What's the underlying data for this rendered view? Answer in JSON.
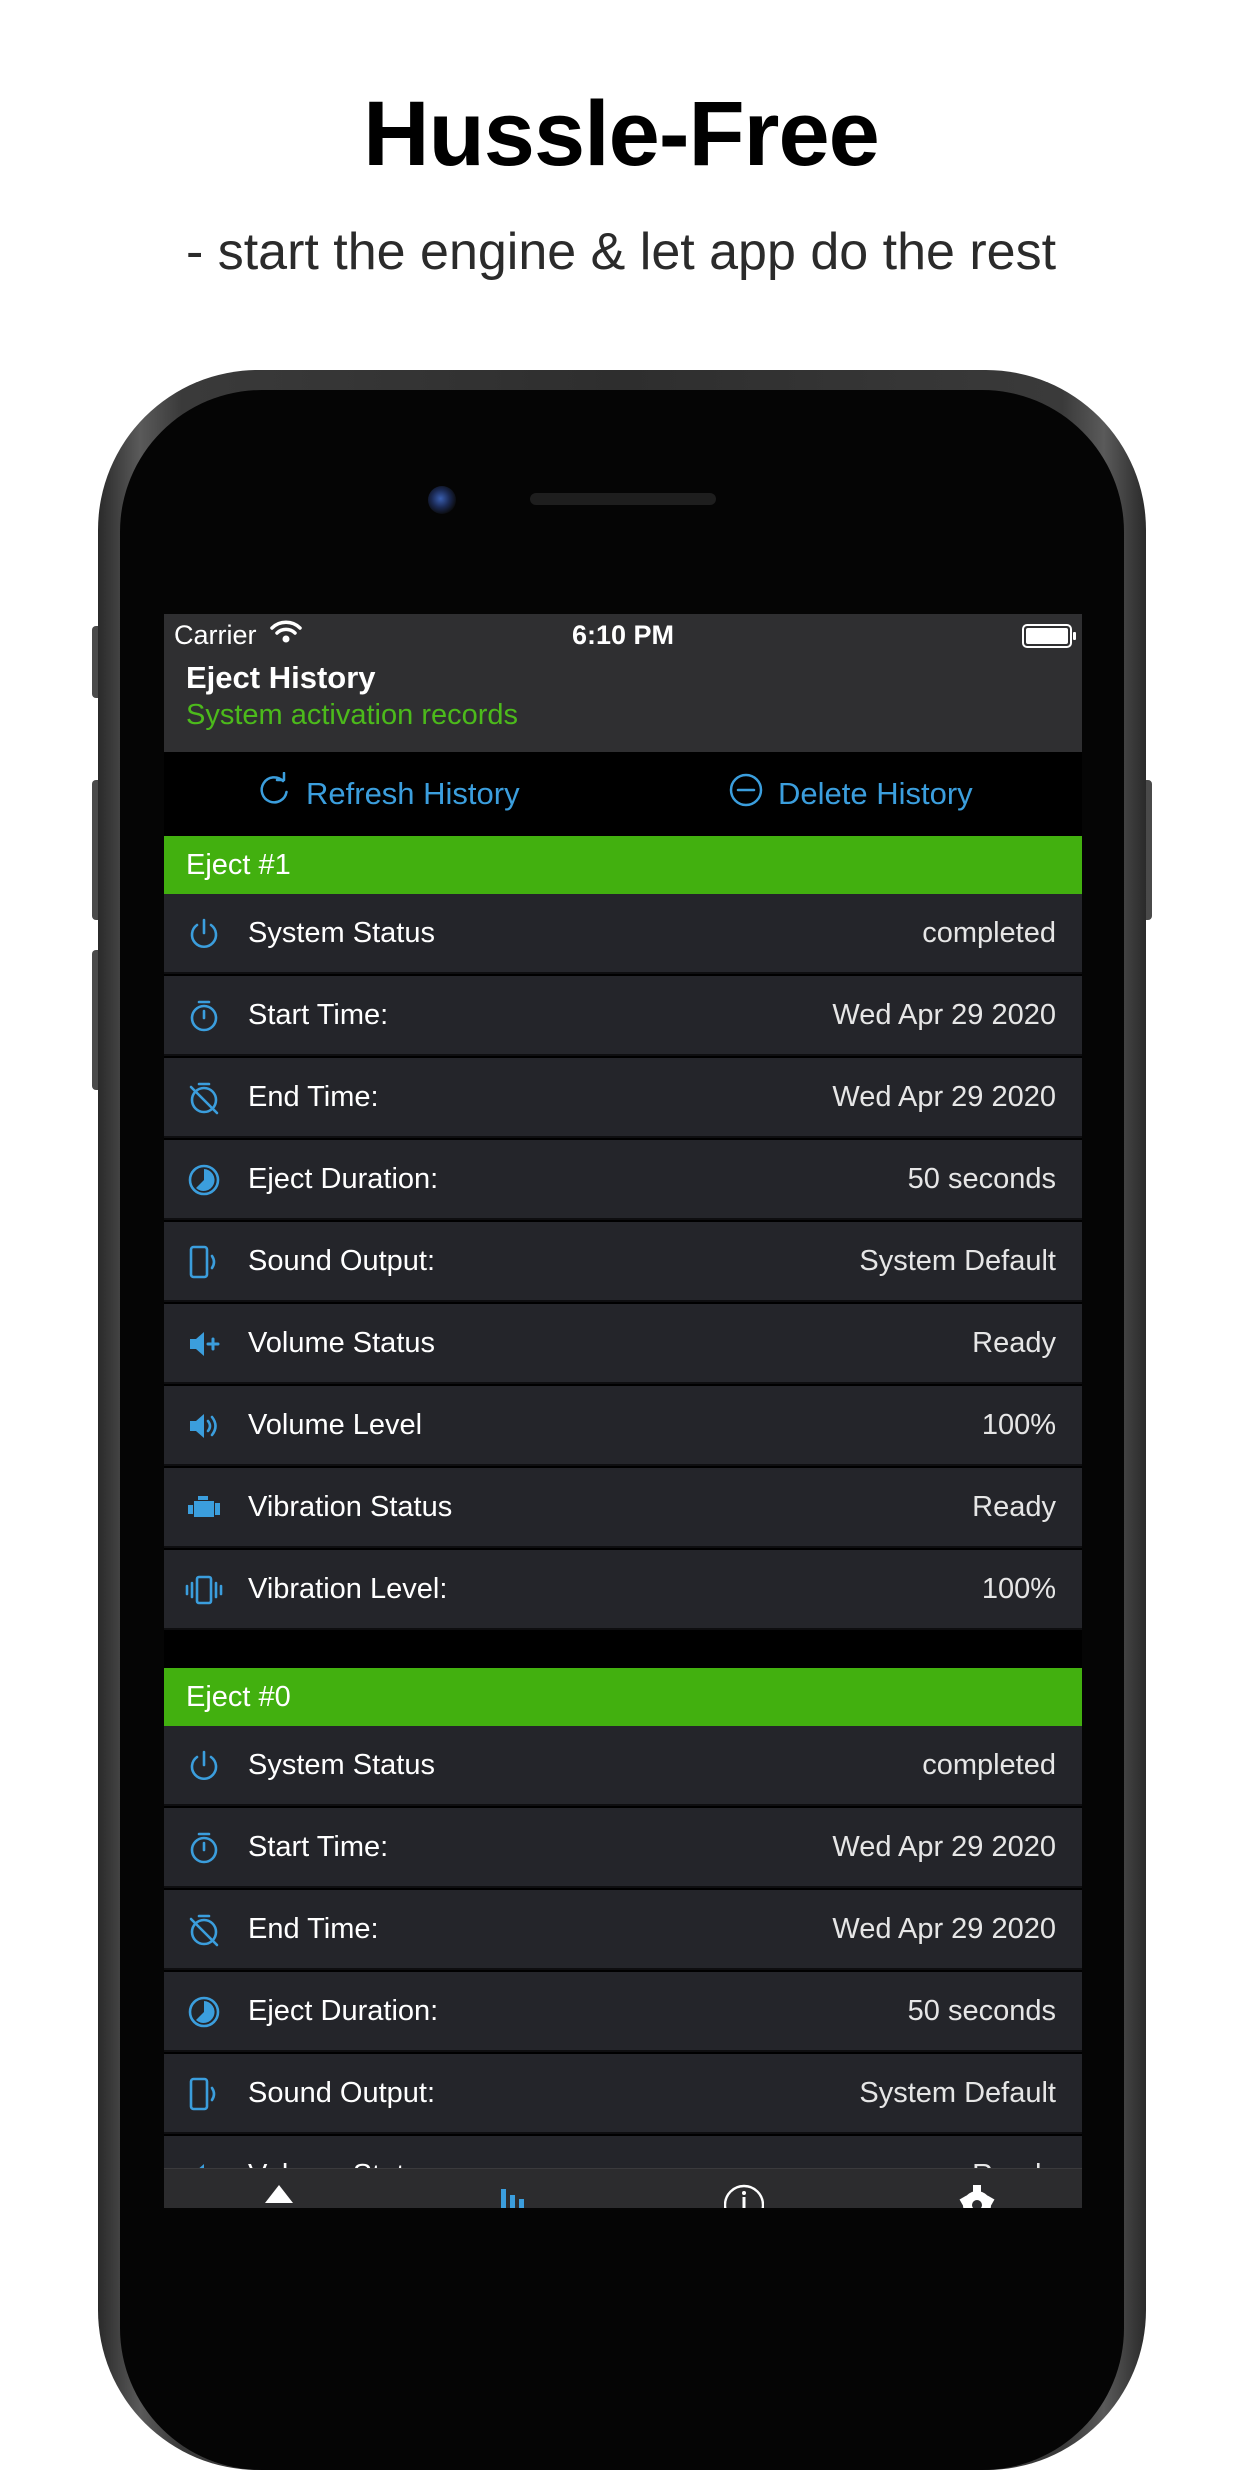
{
  "promo": {
    "headline": "Hussle-Free",
    "subline": "- start the engine & let app do the rest"
  },
  "status_bar": {
    "carrier": "Carrier",
    "time": "6:10 PM"
  },
  "nav": {
    "title": "Eject History",
    "subtitle": "System activation records"
  },
  "actions": {
    "refresh_label": "Refresh History",
    "delete_label": "Delete History"
  },
  "colors": {
    "accent_blue": "#3b9edd",
    "header_green": "#42b00f",
    "subtitle_green": "#4cba1b",
    "row_bg": "#24252a"
  },
  "sections": [
    {
      "title": "Eject #1",
      "rows": [
        {
          "icon": "power-icon",
          "label": "System Status",
          "value": "completed"
        },
        {
          "icon": "stopwatch-icon",
          "label": "Start Time:",
          "value": "Wed Apr 29 2020"
        },
        {
          "icon": "stopwatch-off-icon",
          "label": "End Time:",
          "value": "Wed Apr 29 2020"
        },
        {
          "icon": "clock-pie-icon",
          "label": "Eject Duration:",
          "value": "50 seconds"
        },
        {
          "icon": "phone-sound-icon",
          "label": "Sound Output:",
          "value": "System Default"
        },
        {
          "icon": "volume-plus-icon",
          "label": "Volume Status",
          "value": "Ready"
        },
        {
          "icon": "volume-high-icon",
          "label": "Volume Level",
          "value": "100%"
        },
        {
          "icon": "engine-icon",
          "label": "Vibration Status",
          "value": "Ready"
        },
        {
          "icon": "vibrate-icon",
          "label": "Vibration Level:",
          "value": "100%"
        }
      ]
    },
    {
      "title": "Eject #0",
      "rows": [
        {
          "icon": "power-icon",
          "label": "System Status",
          "value": "completed"
        },
        {
          "icon": "stopwatch-icon",
          "label": "Start Time:",
          "value": "Wed Apr 29 2020"
        },
        {
          "icon": "stopwatch-off-icon",
          "label": "End Time:",
          "value": "Wed Apr 29 2020"
        },
        {
          "icon": "clock-pie-icon",
          "label": "Eject Duration:",
          "value": "50 seconds"
        },
        {
          "icon": "phone-sound-icon",
          "label": "Sound Output:",
          "value": "System Default"
        },
        {
          "icon": "volume-plus-icon",
          "label": "Volume Status",
          "value": "Ready"
        }
      ]
    }
  ],
  "tabbar": {
    "tabs": [
      "home-icon",
      "stats-icon",
      "info-icon",
      "settings-icon"
    ]
  }
}
